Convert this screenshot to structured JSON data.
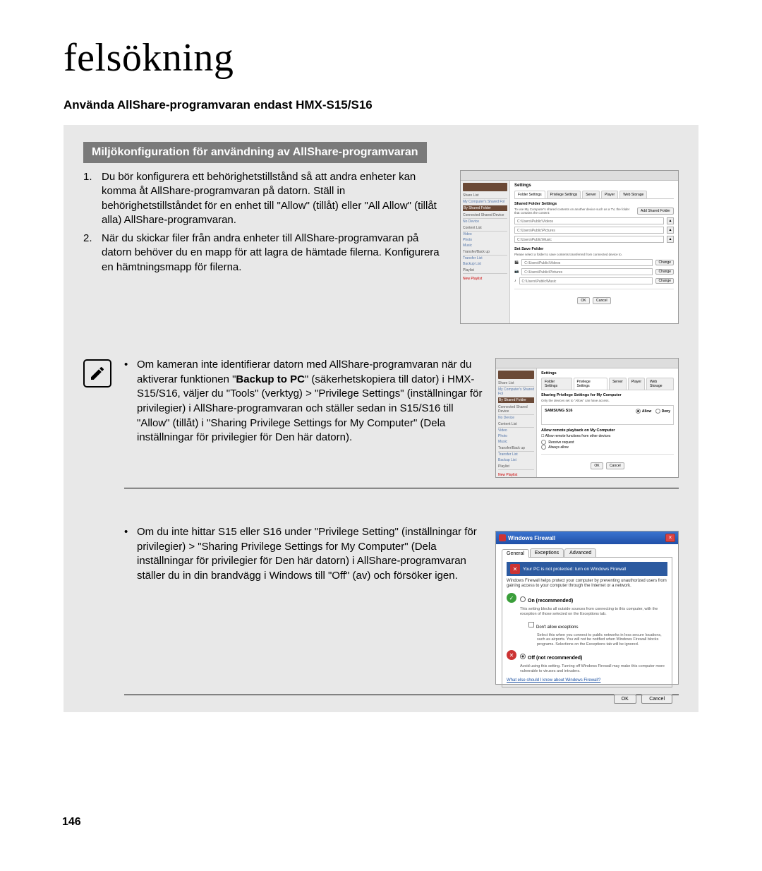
{
  "page_title": "felsökning",
  "subtitle": "Använda AllShare-programvaran endast HMX-S15/S16",
  "banner": "Miljökonfiguration för användning av AllShare-programvaran",
  "list": {
    "item1": "Du bör konfigurera ett behörighetstillstånd så att andra enheter kan komma åt AllShare-programvaran på datorn. Ställ in behörighetstillståndet för en enhet till \"Allow\" (tillåt) eller \"All Allow\" (tillåt alla) AllShare-programvaran.",
    "item2": "När du skickar filer från andra enheter till AllShare-programvaran på datorn behöver du en mapp för att lagra de hämtade filerna. Konfigurera en hämtningsmapp för filerna."
  },
  "note1_pre": "Om kameran inte identifierar datorn med AllShare-programvaran när du aktiverar funktionen \"",
  "note1_bold": "Backup to PC",
  "note1_post": "\" (säkerhetskopiera till dator) i HMX-S15/S16, väljer du \"Tools\" (verktyg) > \"Privilege Settings\" (inställningar för privilegier) i AllShare-programvaran och ställer sedan in S15/S16 till \"Allow\" (tillåt) i \"Sharing Privilege Settings for My Computer\" (Dela inställningar för privilegier för Den här datorn).",
  "note2": "Om du inte hittar S15 eller S16 under \"Privilege Setting\" (inställningar för privilegier) > \"Sharing Privilege Settings for My Computer\" (Dela inställningar för privilegier för Den här datorn) i AllShare-programvaran ställer du in din brandvägg i Windows till \"Off\" (av) och försöker igen.",
  "page_number": "146",
  "allshare_dialog1": {
    "title": "Settings",
    "tabs": [
      "Folder Settings",
      "Privilege Settings",
      "Server",
      "Player",
      "Web Storage"
    ],
    "shared_section_title": "Shared Folder Settings",
    "shared_desc": "To use My Computer's shared contents on another device such as a TV, the folder that contains the content:",
    "add_button": "Add Shared Folder",
    "paths": [
      "C:\\Users\\Public\\Videos",
      "C:\\Users\\Public\\Pictures",
      "C:\\Users\\Public\\Music"
    ],
    "save_section_title": "Set Save Folder",
    "save_desc": "Please select a folder to save contents transferred from connected device to.",
    "save_paths": [
      "C:\\Users\\Public\\Videos",
      "C:\\Users\\Public\\Pictures",
      "C:\\Users\\Public\\Music"
    ],
    "change_button": "Change",
    "ok": "OK",
    "cancel": "Cancel",
    "side_share": "Share List",
    "side_my": "My Computer's Shared Fol",
    "side_shared_folder": "By Shared Folder",
    "side_connected": "Connected Shared Device",
    "side_nodevice": "No Device",
    "side_content": "Content List",
    "side_video": "Video",
    "side_photo": "Photo",
    "side_music": "Music",
    "side_transfer": "Transfer/Back up",
    "side_tlist": "Transfer List",
    "side_blist": "Backup List",
    "side_playlist": "Playlist",
    "side_newlist": "New Playlist"
  },
  "allshare_dialog2": {
    "title": "Settings",
    "tabs": [
      "Folder Settings",
      "Privilege Settings",
      "Server",
      "Player",
      "Web Storage"
    ],
    "section1_title": "Sharing Privilege Settings for My Computer",
    "section1_desc": "Only the devices set to \"Allow\" can have access.",
    "device_label": "SAMSUNG S16",
    "allow": "Allow",
    "deny": "Deny",
    "section2_title": "Allow remote playback on My Computer",
    "checkbox_label": "Allow remote functions from other devices",
    "radio1": "Receive request",
    "radio2": "Always allow",
    "ok": "OK",
    "cancel": "Cancel"
  },
  "firewall": {
    "window_title": "Windows Firewall",
    "tabs": [
      "General",
      "Exceptions",
      "Advanced"
    ],
    "banner": "Your PC is not protected: turn on Windows Firewall",
    "desc": "Windows Firewall helps protect your computer by preventing unauthorized users from gaining access to your computer through the Internet or a network.",
    "opt_on_title": "On (recommended)",
    "opt_on_desc": "This setting blocks all outside sources from connecting to this computer, with the exception of those selected on the Exceptions tab.",
    "opt_on_check": "Don't allow exceptions",
    "opt_on_check_desc": "Select this when you connect to public networks in less secure locations, such as airports. You will not be notified when Windows Firewall blocks programs. Selections on the Exceptions tab will be ignored.",
    "opt_off_title": "Off (not recommended)",
    "opt_off_desc": "Avoid using this setting. Turning off Windows Firewall may make this computer more vulnerable to viruses and intruders.",
    "link": "What else should I know about Windows Firewall?",
    "ok": "OK",
    "cancel": "Cancel"
  }
}
